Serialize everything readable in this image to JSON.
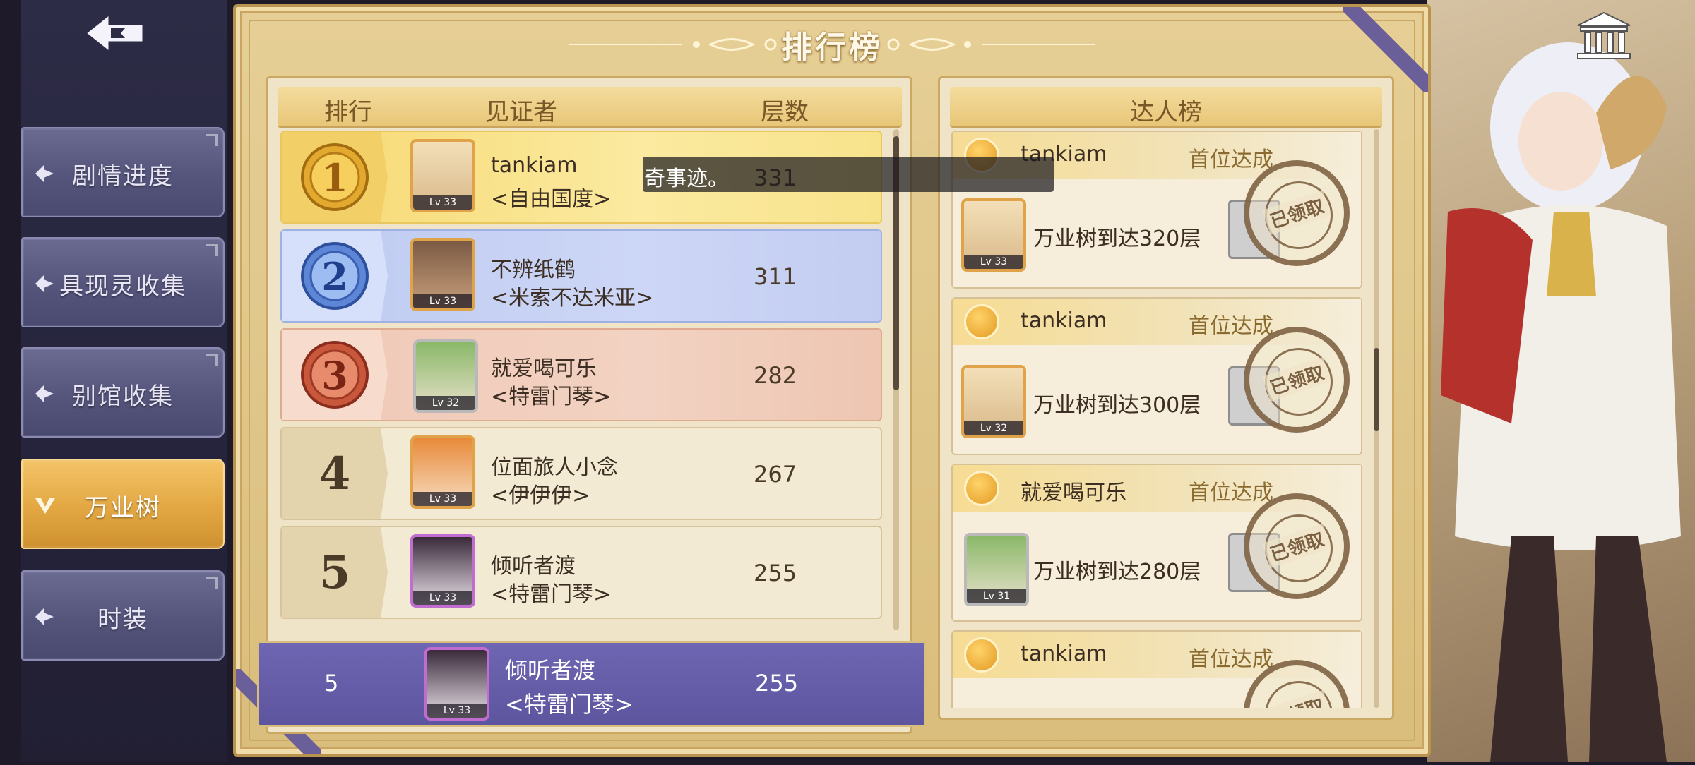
{
  "header": {
    "title": "排行榜"
  },
  "nav": {
    "items": [
      {
        "label": "剧情进度",
        "active": false
      },
      {
        "label": "具现灵收集",
        "active": false
      },
      {
        "label": "别馆收集",
        "active": false
      },
      {
        "label": "万业树",
        "active": true
      },
      {
        "label": "时装",
        "active": false
      }
    ]
  },
  "ranking": {
    "headers": {
      "rank": "排行",
      "witness": "见证者",
      "floors": "层数"
    },
    "rows": [
      {
        "rank": "1",
        "name": "tankiam",
        "guild": "<自由国度>",
        "floors": "331",
        "level": "Lv 33"
      },
      {
        "rank": "2",
        "name": "不辨纸鹤",
        "guild": "<米索不达米亚>",
        "floors": "311",
        "level": "Lv 33"
      },
      {
        "rank": "3",
        "name": "就爱喝可乐",
        "guild": "<特雷门琴>",
        "floors": "282",
        "level": "Lv 32"
      },
      {
        "rank": "4",
        "name": "位面旅人小念",
        "guild": "<伊伊伊>",
        "floors": "267",
        "level": "Lv 33"
      },
      {
        "rank": "5",
        "name": "倾听者渡",
        "guild": "<特雷门琴>",
        "floors": "255",
        "level": "Lv 33"
      }
    ],
    "me": {
      "rank": "5",
      "name": "倾听者渡",
      "guild": "<特雷门琴>",
      "floors": "255",
      "level": "Lv 33"
    }
  },
  "tooltip": {
    "text": "奇事迹。"
  },
  "achievers": {
    "title": "达人榜",
    "cards": [
      {
        "name": "tankiam",
        "first": "首位达成",
        "achievement": "万业树到达320层",
        "level": "Lv 33",
        "stamp": "已领取"
      },
      {
        "name": "tankiam",
        "first": "首位达成",
        "achievement": "万业树到达300层",
        "level": "Lv 32",
        "stamp": "已领取"
      },
      {
        "name": "就爱喝可乐",
        "first": "首位达成",
        "achievement": "万业树到达280层",
        "level": "Lv 31",
        "stamp": "已领取"
      },
      {
        "name": "tankiam",
        "first": "首位达成",
        "achievement": "",
        "level": "",
        "stamp": "已领取"
      }
    ]
  },
  "colors": {
    "active_nav": "#e2a742",
    "nav": "#55557c",
    "my_row": "#5d559e",
    "gold": "#caa862"
  }
}
